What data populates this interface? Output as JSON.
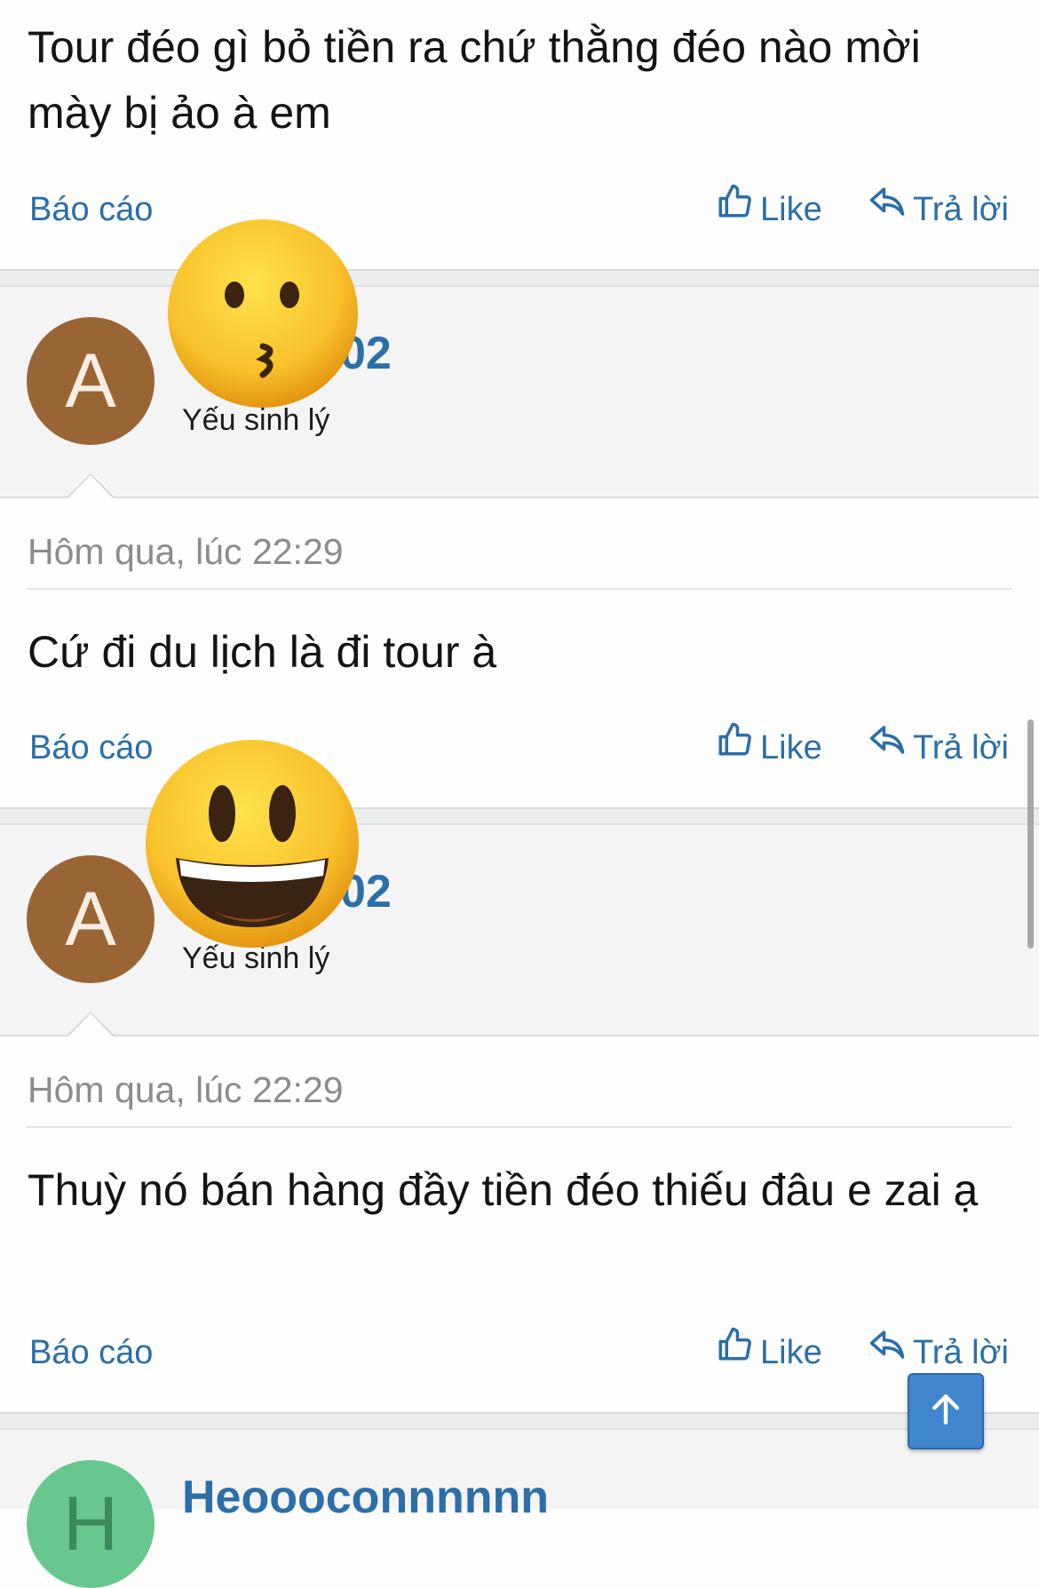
{
  "posts": [
    {
      "text": "Tour đéo gì bỏ tiền ra chứ thằng đéo nào mời mày bị ảo à em",
      "report": "Báo cáo",
      "like": "Like",
      "reply": "Trả lời"
    },
    {
      "avatar_letter": "A",
      "username_visible": "02",
      "user_title": "Yếu sinh lý",
      "date": "Hôm qua, lúc 22:29",
      "text": "Cứ đi du lịch là đi tour à",
      "report": "Báo cáo",
      "like": "Like",
      "reply": "Trả lời",
      "sticker": "kissing-face-emoji"
    },
    {
      "avatar_letter": "A",
      "username_visible": "02",
      "user_title": "Yếu sinh lý",
      "date": "Hôm qua, lúc 22:29",
      "text": "Thuỳ nó bán hàng đầy tiền đéo thiếu đâu e zai ạ",
      "report": "Báo cáo",
      "like": "Like",
      "reply": "Trả lời",
      "sticker": "grinning-face-emoji"
    },
    {
      "avatar_letter": "H",
      "username": "Heoooconnnnnn"
    }
  ],
  "icons": {
    "like": "thumbs-up-icon",
    "reply": "reply-arrow-icon",
    "scroll_top": "arrow-up-icon"
  },
  "colors": {
    "link": "#2b6ea9",
    "username": "#2c6fa8",
    "avatar_brown": "#9a6534",
    "avatar_green": "#67c78e",
    "scroll_top_button": "#3f86cf"
  }
}
